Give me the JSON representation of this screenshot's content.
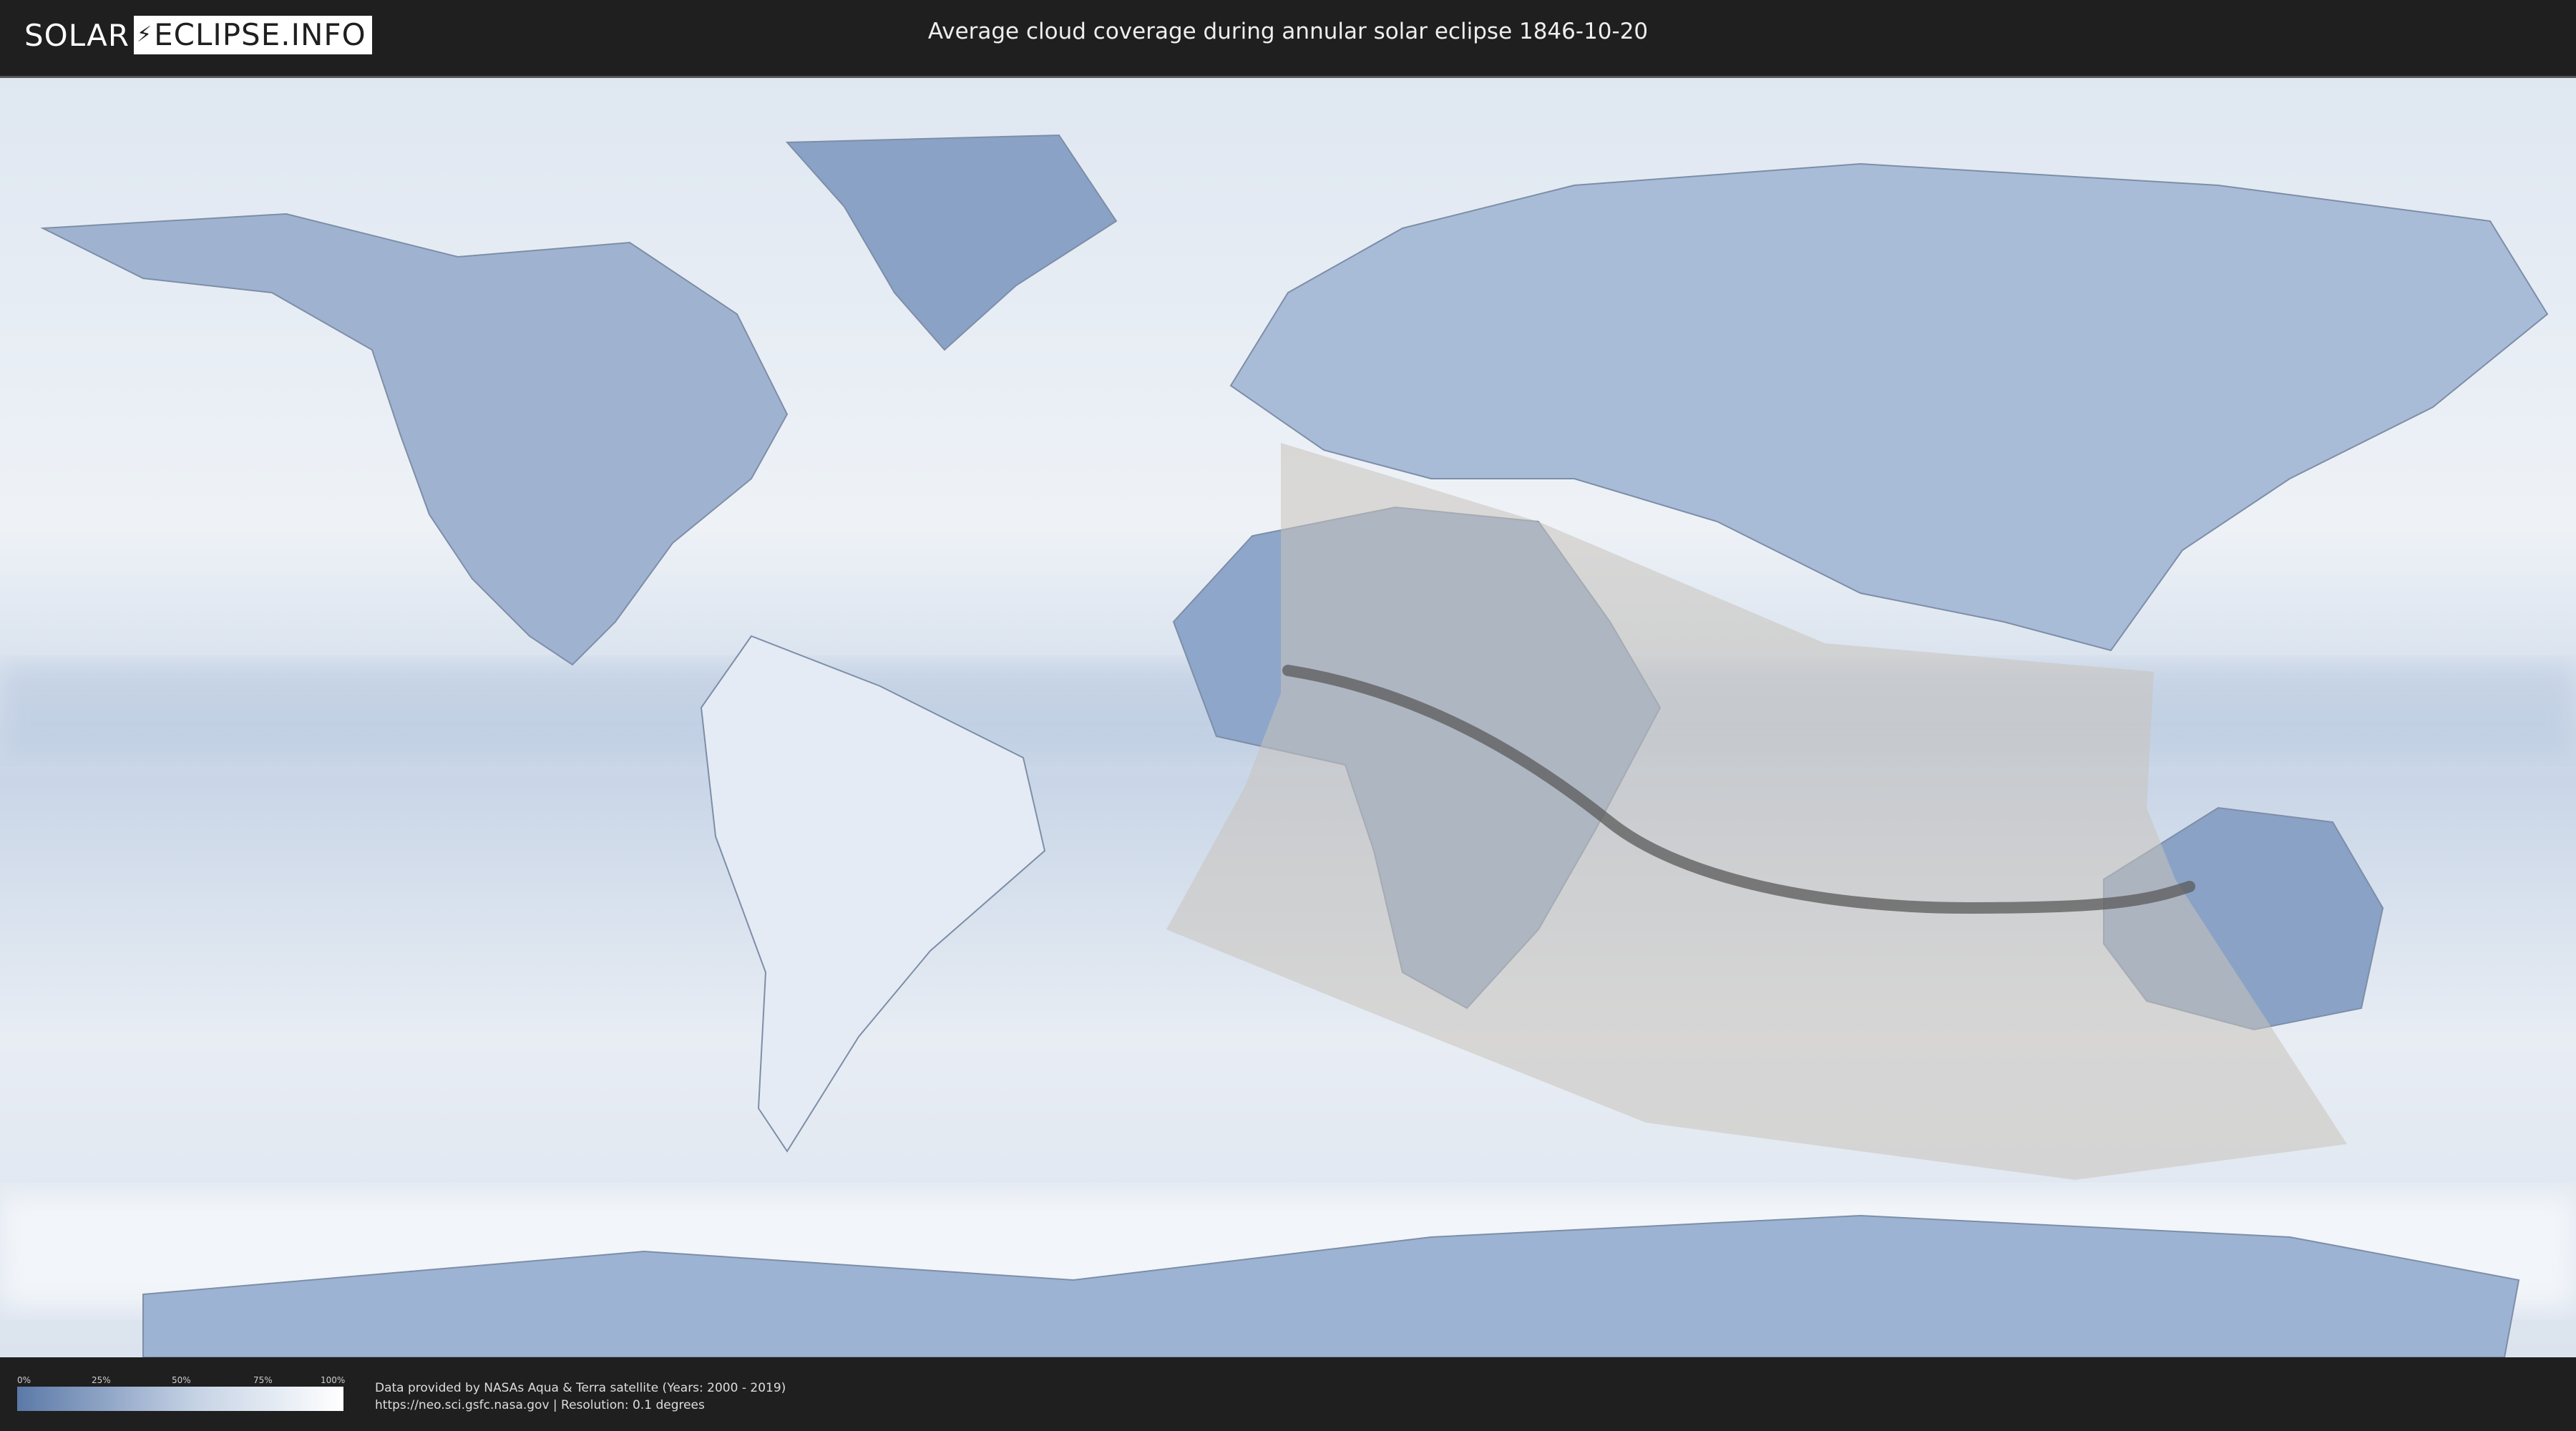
{
  "header": {
    "logo": {
      "solar": "SOLAR",
      "eclipse": "ECLIPSE.INFO",
      "bolt_icon": "lightning-bolt-icon"
    },
    "title": "Average cloud coverage during annular solar eclipse 1846-10-20"
  },
  "map": {
    "colors": {
      "ocean_clear": "#f2f5f9",
      "cloud_dark": "#6d88b4",
      "cloud_mid": "#a9bcd6",
      "eclipse_shade": "#c8c2bb",
      "central_line": "#5a5a5a",
      "coastline": "#7d8ea8"
    }
  },
  "footer": {
    "legend": {
      "ticks": [
        "0%",
        "25%",
        "50%",
        "75%",
        "100%"
      ]
    },
    "credits": [
      "Data provided by NASAs Aqua & Terra satellite (Years: 2000 - 2019)",
      "https://neo.sci.gsfc.nasa.gov | Resolution: 0.1 degrees"
    ]
  }
}
